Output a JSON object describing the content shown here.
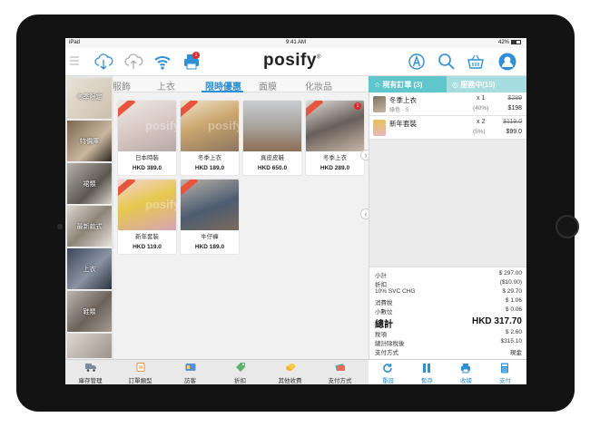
{
  "status": {
    "carrier": "iPad",
    "time": "9:41 AM",
    "battery": "42%"
  },
  "header": {
    "logo": "posify",
    "logo_mark": "®",
    "printer_badge": "1"
  },
  "tabs": [
    {
      "label": "服飾"
    },
    {
      "label": "上衣"
    },
    {
      "label": "限時優惠"
    },
    {
      "label": "面膜"
    },
    {
      "label": "化妝品"
    }
  ],
  "order_tabs": {
    "current": "現有訂單 (3)",
    "service": "服務中(15)"
  },
  "sidebar": [
    {
      "label": "冬季限定"
    },
    {
      "label": "特價庫"
    },
    {
      "label": "裙類"
    },
    {
      "label": "最新款式"
    },
    {
      "label": "上衣"
    },
    {
      "label": "鞋類"
    }
  ],
  "products": [
    {
      "name": "日本時裝",
      "price": "HKD 389.0"
    },
    {
      "name": "冬季上衣",
      "price": "HKD 189.0"
    },
    {
      "name": "真皮皮鞋",
      "price": "HKD 650.0"
    },
    {
      "name": "冬季上衣",
      "price": "HKD 289.0",
      "dot": "1"
    },
    {
      "name": "新年套裝",
      "price": "HKD 119.0"
    },
    {
      "name": "牛仔褲",
      "price": "HKD 189.0"
    }
  ],
  "watermark": "posify",
  "order_lines": [
    {
      "name": "冬季上衣",
      "variant": "綠色 · S",
      "qty": "x 1",
      "discount": "(40%)",
      "old_price": "$289",
      "price": "$198"
    },
    {
      "name": "新年套裝",
      "variant": "",
      "qty": "x 2",
      "discount": "(5%)",
      "old_price": "$119.0",
      "price": "$99.0"
    }
  ],
  "totals": [
    {
      "label": "小計",
      "value": "$ 297.00"
    },
    {
      "label": "折扣",
      "value": "($10.00)"
    },
    {
      "label": "10% SVC CHG",
      "value": "$ 29.70"
    },
    {
      "label": "消費稅",
      "value": "$ 1.06"
    },
    {
      "label": "小數位",
      "value": "$ 0.06"
    },
    {
      "label": "總計",
      "value": "HKD 317.70"
    },
    {
      "label": "稅項",
      "value": "$ 2.60"
    },
    {
      "label": "總計除稅後",
      "value": "$315.10"
    },
    {
      "label": "支付方式",
      "value": "現金"
    }
  ],
  "bottom_left": [
    {
      "label": "庫存管理"
    },
    {
      "label": "訂單類型"
    },
    {
      "label": "訪客"
    },
    {
      "label": "折扣"
    },
    {
      "label": "其他收費"
    },
    {
      "label": "支付方式"
    }
  ],
  "bottom_right": [
    {
      "label": "重設"
    },
    {
      "label": "暫存"
    },
    {
      "label": "收據"
    },
    {
      "label": "支付"
    }
  ],
  "colors": {
    "accent": "#2d8fd5",
    "teal": "#5ec6cc",
    "badge_red": "#e8553e"
  }
}
